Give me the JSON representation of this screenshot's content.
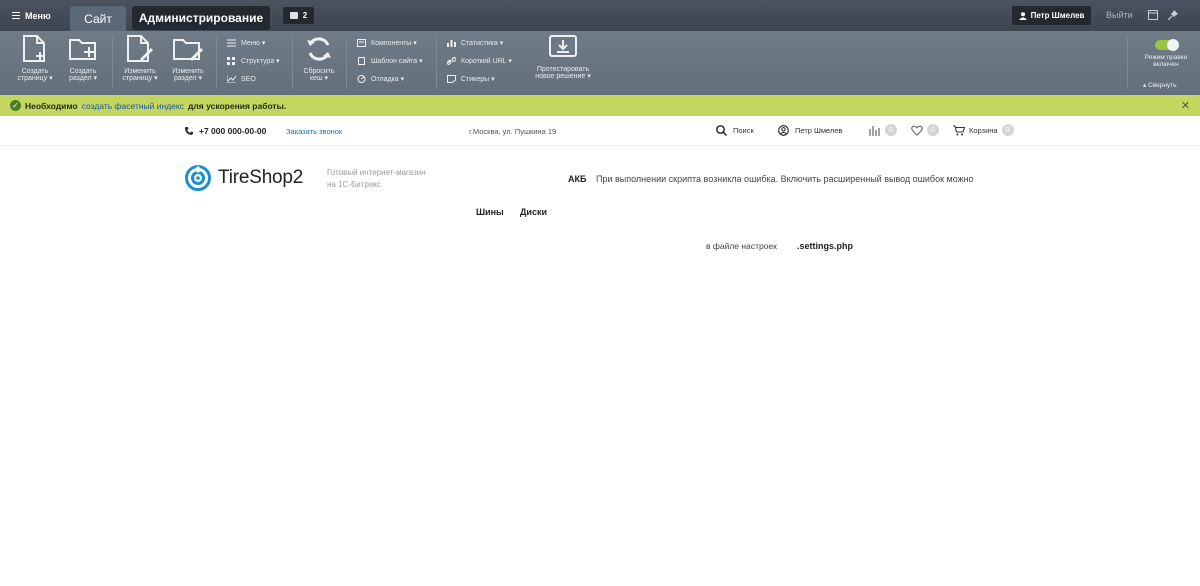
{
  "topbar": {
    "menu_label": "Меню",
    "tab_site": "Сайт",
    "tab_admin": "Администрирование",
    "notifications_count": "2",
    "user_name": "Петр Шмелев",
    "logout_label": "Выйти"
  },
  "toolbar": {
    "create_page": "Создать странцу",
    "create_page_l1": "Создать",
    "create_page_l2": "страницу ▾",
    "create_section_l1": "Создать",
    "create_section_l2": "раздел ▾",
    "edit_page_l1": "Изменить",
    "edit_page_l2": "страницу ▾",
    "edit_section_l1": "Изменить",
    "edit_section_l2": "раздел ▾",
    "menu": "Меню ▾",
    "structure": "Структура ▾",
    "seo": "SEO",
    "reset_cache_l1": "Сбросить",
    "reset_cache_l2": "кеш ▾",
    "components": "Компоненты ▾",
    "site_template": "Шаблон сайта ▾",
    "debug": "Отладка ▾",
    "statistics": "Статистика ▾",
    "short_url": "Короткий URL ▾",
    "stickers": "Стикеры ▾",
    "test_l1": "Протестировать",
    "test_l2": "новое решение ▾",
    "edit_mode_l1": "Режим правки",
    "edit_mode_l2": "включен",
    "collapse": "Свернуть"
  },
  "notice": {
    "prefix": "Необходимо",
    "link": "создать фасетный индекс",
    "suffix": "для ускорения работы."
  },
  "header": {
    "phone": "+7 000 000-00-00",
    "callback": "Заказать звонок",
    "address": "г.Москва, ул. Пушкина 19",
    "search": "Поиск",
    "user": "Петр Шмелев",
    "compare_count": "0",
    "favorites_count": "0",
    "cart_label": "Корзина",
    "cart_count": "0"
  },
  "logo": {
    "text": "TireShop2",
    "slogan_l1": "Готовый интернет-магазин",
    "slogan_l2": "на 1С-Битрикс"
  },
  "content": {
    "akb": "АКБ",
    "error_text": "При выполнении скрипта возникла ошибка. Включить расширенный вывод ошибок можно",
    "error_text2": "в файле настроек",
    "error_file": ".settings.php"
  },
  "nav": {
    "tires": "Шины",
    "disks": "Диски"
  }
}
